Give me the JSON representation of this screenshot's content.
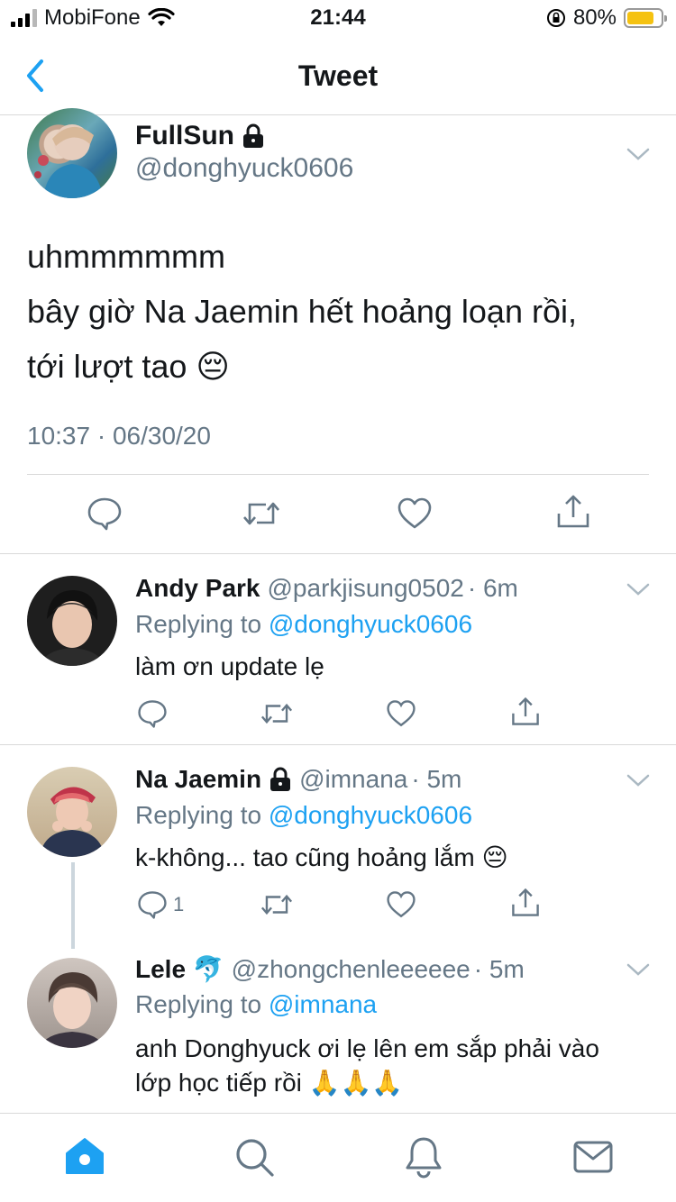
{
  "status_bar": {
    "carrier": "MobiFone",
    "time": "21:44",
    "battery": "80%",
    "battery_level": 0.8
  },
  "nav": {
    "title": "Tweet",
    "back_icon": "chevron-left-icon"
  },
  "main_tweet": {
    "name": "FullSun",
    "handle": "@donghyuck0606",
    "lines": [
      "uhmmmmmm",
      "bây giờ Na Jaemin hết hoảng loạn rồi,",
      "tới lượt tao 😔"
    ],
    "timestamp": "10:37 · 06/30/20",
    "locked": true
  },
  "replies": [
    {
      "name": "Andy Park",
      "handle": "@parkjisung0502",
      "time": "· 6m",
      "replying_label": "Replying to",
      "replying_to": "@donghyuck0606",
      "text": "làm ơn update lẹ",
      "reply_count": ""
    },
    {
      "name": "Na Jaemin",
      "handle": "@imnana",
      "time": "· 5m",
      "replying_label": "Replying to",
      "replying_to": "@donghyuck0606",
      "text": "k-không... tao cũng hoảng lắm 😔",
      "reply_count": "1"
    },
    {
      "name": "Lele 🐬",
      "handle": "@zhongchenleeeeee",
      "time": "· 5m",
      "replying_label": "Replying to",
      "replying_to": "@imnana",
      "text_lines": [
        "anh Donghyuck ơi lẹ lên em sắp phải vào",
        "lớp học tiếp rồi 🙏🙏🙏"
      ]
    }
  ],
  "tabs": [
    "home-icon",
    "search-icon",
    "notifications-icon",
    "messages-icon"
  ],
  "colors": {
    "accent": "#1da1f2",
    "secondary_text": "#657786",
    "divider": "#d9d9d9"
  }
}
